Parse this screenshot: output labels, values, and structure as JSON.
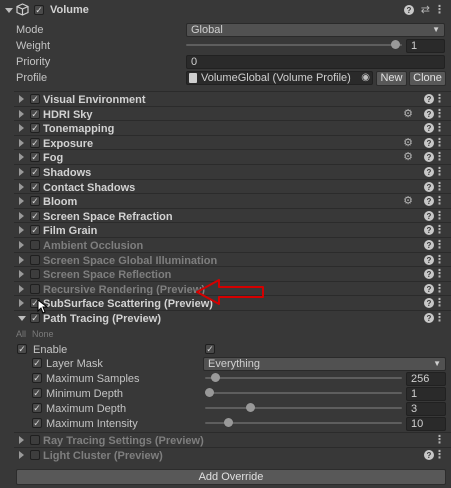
{
  "header": {
    "title": "Volume"
  },
  "props": {
    "mode_label": "Mode",
    "mode_value": "Global",
    "weight_label": "Weight",
    "weight_value": "1",
    "weight_level": 1.0,
    "priority_label": "Priority",
    "priority_value": "0",
    "profile_label": "Profile",
    "profile_value": "VolumeGlobal (Volume Profile)",
    "new_label": "New",
    "clone_label": "Clone"
  },
  "overrides": [
    {
      "label": "Visual Environment",
      "enabled": true,
      "gear": false
    },
    {
      "label": "HDRI Sky",
      "enabled": true,
      "gear": true
    },
    {
      "label": "Tonemapping",
      "enabled": true,
      "gear": false
    },
    {
      "label": "Exposure",
      "enabled": true,
      "gear": true
    },
    {
      "label": "Fog",
      "enabled": true,
      "gear": true
    },
    {
      "label": "Shadows",
      "enabled": true,
      "gear": false
    },
    {
      "label": "Contact Shadows",
      "enabled": true,
      "gear": false
    },
    {
      "label": "Bloom",
      "enabled": true,
      "gear": true
    },
    {
      "label": "Screen Space Refraction",
      "enabled": true,
      "gear": false
    },
    {
      "label": "Film Grain",
      "enabled": true,
      "gear": false
    },
    {
      "label": "Ambient Occlusion",
      "enabled": false,
      "gear": false
    },
    {
      "label": "Screen Space Global Illumination",
      "enabled": false,
      "gear": false
    },
    {
      "label": "Screen Space Reflection",
      "enabled": false,
      "gear": false
    },
    {
      "label": "Recursive Rendering (Preview)",
      "enabled": false,
      "gear": false
    },
    {
      "label": "SubSurface Scattering (Preview)",
      "enabled": true,
      "gear": false
    },
    {
      "label": "Path Tracing (Preview)",
      "enabled": true,
      "gear": false
    }
  ],
  "path_tracing": {
    "all_label": "All",
    "none_label": "None",
    "enable_label": "Enable",
    "layer_mask_label": "Layer Mask",
    "layer_mask_value": "Everything",
    "max_samples_label": "Maximum Samples",
    "max_samples_value": "256",
    "max_samples_level": 0.03,
    "min_depth_label": "Minimum Depth",
    "min_depth_value": "1",
    "min_depth_level": 0.0,
    "max_depth_label": "Maximum Depth",
    "max_depth_value": "3",
    "max_depth_level": 0.22,
    "max_intensity_label": "Maximum Intensity",
    "max_intensity_value": "10",
    "max_intensity_level": 0.1
  },
  "after": [
    {
      "label": "Ray Tracing Settings (Preview)"
    },
    {
      "label": "Light Cluster (Preview)"
    }
  ],
  "add_override_label": "Add Override",
  "colors": {
    "annotation_arrow": "#d40000",
    "background": "#383838"
  }
}
